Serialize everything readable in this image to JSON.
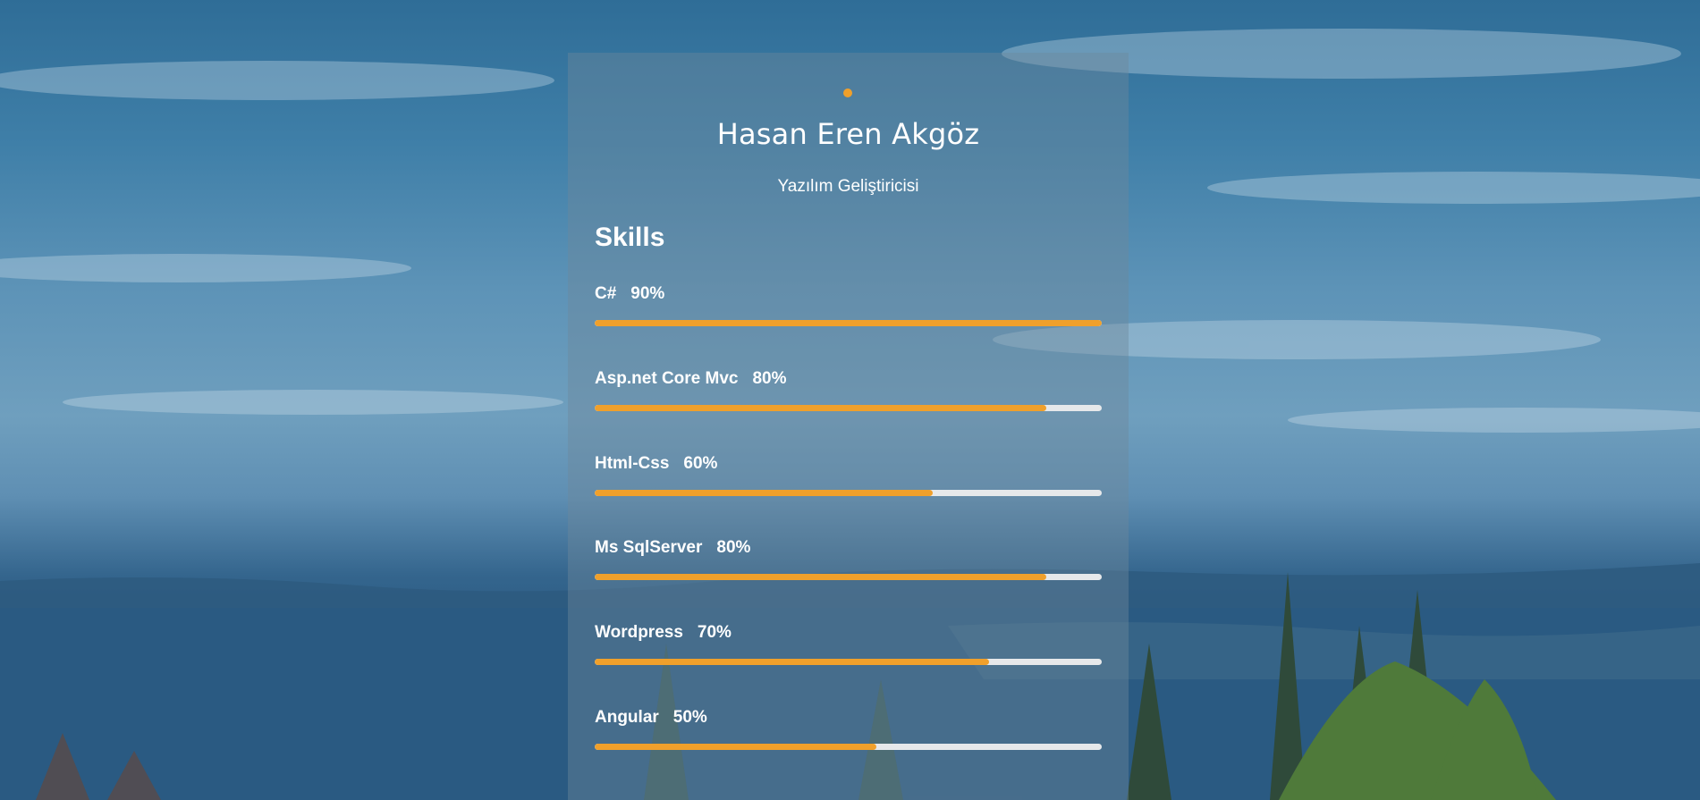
{
  "profile": {
    "name": "Hasan Eren Akgöz",
    "title": "Yazılım Geliştiricisi"
  },
  "skills_section": {
    "heading": "Skills",
    "items": [
      {
        "name": "C#",
        "percent_label": "90%",
        "level": 1.0
      },
      {
        "name": "Asp.net Core Mvc",
        "percent_label": "80%",
        "level": 0.89
      },
      {
        "name": "Html-Css",
        "percent_label": "60%",
        "level": 0.667
      },
      {
        "name": "Ms SqlServer",
        "percent_label": "80%",
        "level": 0.89
      },
      {
        "name": "Wordpress",
        "percent_label": "70%",
        "level": 0.778
      },
      {
        "name": "Angular",
        "percent_label": "50%",
        "level": 0.556
      }
    ]
  },
  "colors": {
    "accent": "#f0a02b",
    "track": "#e6e8ea"
  }
}
